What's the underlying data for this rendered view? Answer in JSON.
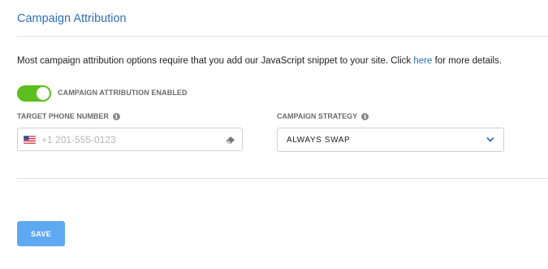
{
  "section": {
    "title": "Campaign Attribution"
  },
  "intro": {
    "text_before": "Most campaign attribution options require that you add our JavaScript snippet to your site. Click ",
    "link_text": "here",
    "text_after": " for more details."
  },
  "toggle": {
    "label": "CAMPAIGN ATTRIBUTION ENABLED",
    "enabled": true,
    "color": "#5cbf1f"
  },
  "phone": {
    "label": "TARGET PHONE NUMBER",
    "placeholder": "+1 201-555-0123",
    "value": "",
    "flag_icon": "us-flag-icon",
    "clear_icon": "eraser-icon"
  },
  "strategy": {
    "label": "CAMPAIGN STRATEGY",
    "selected": "ALWAYS SWAP",
    "icon": "chevron-down-icon"
  },
  "actions": {
    "save_label": "SAVE",
    "save_color": "#5fa8f2"
  },
  "colors": {
    "accent": "#2f6fb5"
  }
}
